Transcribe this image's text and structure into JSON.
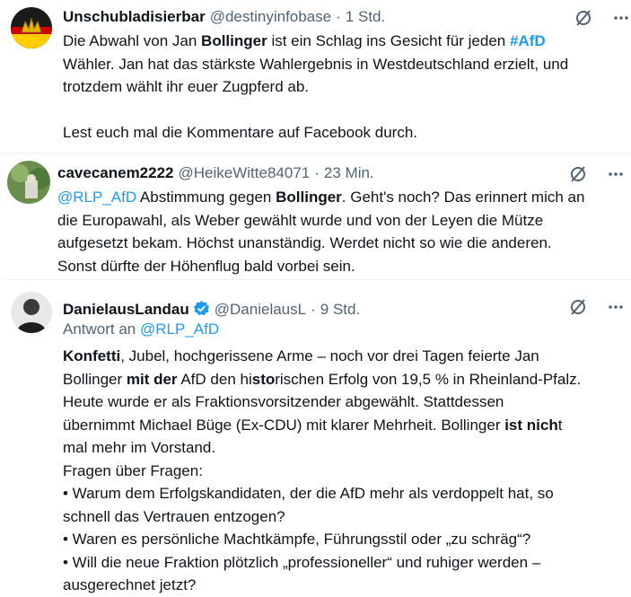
{
  "tweet1": {
    "name": "Unschubladisierbar",
    "handle": "@destinyinfobase",
    "sep": "·",
    "time": "1 Std.",
    "l1_a": "Die Abwahl von Jan ",
    "l1_b": "Bollinger",
    "l1_c": " ist ein Schlag ins Gesicht für jeden ",
    "l1_d": "#AfD",
    "l2": "Wähler. Jan hat das stärkste Wahlergebnis in Westdeutschland erzielt, und",
    "l3": "trotzdem wählt ihr euer Zugpferd ab.",
    "l5": "Lest euch mal die Kommentare auf Facebook durch."
  },
  "tweet2": {
    "name": "cavecanem2222",
    "handle": "@HeikeWitte84071",
    "sep": "·",
    "time": "23 Min.",
    "l1_a": "@RLP_AfD",
    "l1_b": " Abstimmung gegen ",
    "l1_c": "Bollinger",
    "l1_d": ". Geht's noch? Das erinnert mich an",
    "l2": "die Europawahl, als Weber gewählt wurde und von der Leyen die Mütze",
    "l3": "aufgesetzt bekam. Höchst unanständig. Werdet nicht so wie die anderen.",
    "l4": "Sonst dürfte der Höhenflug bald vorbei sein."
  },
  "tweet3": {
    "name": "DanielausLandau",
    "handle": "@DanielausL",
    "sep": "·",
    "time": "9 Std.",
    "reply_prefix": "Antwort an ",
    "reply_handle": "@RLP_AfD",
    "l1_a": "Konfetti",
    "l1_b": ", Jubel, hochgerissene Arme – noch vor drei Tagen feierte Jan",
    "l2_a": "Bollinger ",
    "l2_b": "mit der",
    "l2_c": " AfD den hi",
    "l2_d": "sto",
    "l2_e": "rischen Erfolg von 19,5 % in Rheinland-Pfalz.",
    "l3": "Heute wurde er als Fraktionsvorsitzender abgewählt. Stattdessen",
    "l4": "übernimmt Michael Büge (Ex-CDU) mit klarer Mehrheit. Bollinger ",
    "l4_b": "ist nich",
    "l4_c": "t",
    "l5": "mal mehr im Vorstand.",
    "l6": "Fragen über Fragen:",
    "l7": "• Warum dem Erfolgskandidaten, der die AfD mehr als verdoppelt hat, so",
    "l8": "schnell das Vertrauen entzogen?",
    "l9": "• Waren es persönliche Machtkämpfe, Führungsstil oder „zu schräg“?",
    "l10": "• Will die neue Fraktion plötzlich „professioneller“ und ruhiger werden –",
    "l11": "ausgerechnet jetzt?"
  },
  "icons": {
    "grok": "grok-icon",
    "more": "more-icon",
    "verified": "verified-badge-icon"
  },
  "colors": {
    "link": "#1d9bf0",
    "muted": "#536471",
    "text": "#0f1419"
  }
}
